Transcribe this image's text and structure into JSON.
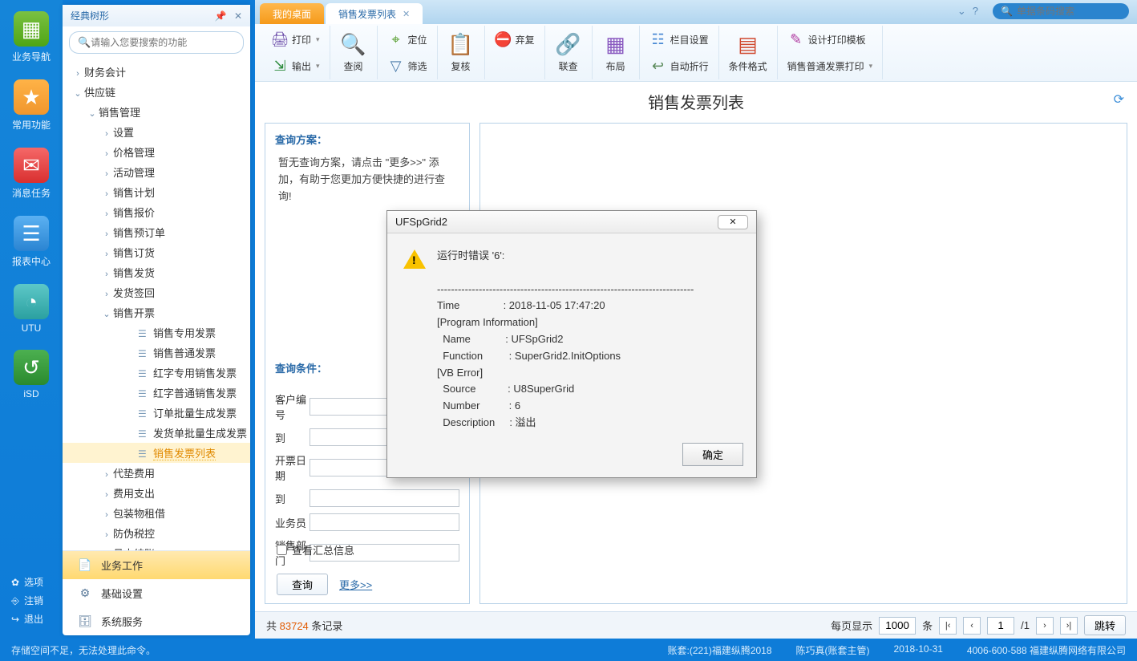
{
  "tree_panel_title": "经典树形",
  "tree_search_placeholder": "请输入您要搜索的功能",
  "rail": [
    {
      "label": "业务导航",
      "cls": "ri-green",
      "glyph": "▦"
    },
    {
      "label": "常用功能",
      "cls": "ri-orange",
      "glyph": "★"
    },
    {
      "label": "消息任务",
      "cls": "ri-red",
      "glyph": "✉"
    },
    {
      "label": "报表中心",
      "cls": "ri-blue",
      "glyph": "☰"
    },
    {
      "label": "UTU",
      "cls": "ri-teal",
      "glyph": "◔"
    },
    {
      "label": "iSD",
      "cls": "ri-dgreen",
      "glyph": "↺"
    }
  ],
  "rail_bottom": [
    {
      "ico": "✿",
      "label": "选项"
    },
    {
      "ico": "⎆",
      "label": "注销"
    },
    {
      "ico": "↪",
      "label": "退出"
    }
  ],
  "tree": [
    {
      "lvl": 0,
      "expand": "›",
      "label": "财务会计"
    },
    {
      "lvl": 0,
      "expand": "⌄",
      "label": "供应链"
    },
    {
      "lvl": 1,
      "expand": "⌄",
      "label": "销售管理"
    },
    {
      "lvl": 2,
      "expand": "›",
      "label": "设置"
    },
    {
      "lvl": 2,
      "expand": "›",
      "label": "价格管理"
    },
    {
      "lvl": 2,
      "expand": "›",
      "label": "活动管理"
    },
    {
      "lvl": 2,
      "expand": "›",
      "label": "销售计划"
    },
    {
      "lvl": 2,
      "expand": "›",
      "label": "销售报价"
    },
    {
      "lvl": 2,
      "expand": "›",
      "label": "销售预订单"
    },
    {
      "lvl": 2,
      "expand": "›",
      "label": "销售订货"
    },
    {
      "lvl": 2,
      "expand": "›",
      "label": "销售发货"
    },
    {
      "lvl": 2,
      "expand": "›",
      "label": "发货签回"
    },
    {
      "lvl": 2,
      "expand": "⌄",
      "label": "销售开票"
    },
    {
      "lvl": 3,
      "leaf": true,
      "label": "销售专用发票"
    },
    {
      "lvl": 3,
      "leaf": true,
      "label": "销售普通发票"
    },
    {
      "lvl": 3,
      "leaf": true,
      "label": "红字专用销售发票"
    },
    {
      "lvl": 3,
      "leaf": true,
      "label": "红字普通销售发票"
    },
    {
      "lvl": 3,
      "leaf": true,
      "label": "订单批量生成发票"
    },
    {
      "lvl": 3,
      "leaf": true,
      "label": "发货单批量生成发票"
    },
    {
      "lvl": 3,
      "leaf": true,
      "label": "销售发票列表",
      "active": true
    },
    {
      "lvl": 2,
      "expand": "›",
      "label": "代垫费用"
    },
    {
      "lvl": 2,
      "expand": "›",
      "label": "费用支出"
    },
    {
      "lvl": 2,
      "expand": "›",
      "label": "包装物租借"
    },
    {
      "lvl": 2,
      "expand": "›",
      "label": "防伪税控"
    },
    {
      "lvl": 2,
      "expand": "›",
      "label": "月末结账"
    }
  ],
  "tree_bottom": [
    {
      "ico": "📄",
      "label": "业务工作",
      "active": true
    },
    {
      "ico": "⚙",
      "label": "基础设置"
    },
    {
      "ico": "🗄",
      "label": "系统服务"
    }
  ],
  "tabs": [
    {
      "label": "我的桌面",
      "type": "home"
    },
    {
      "label": "销售发票列表",
      "type": "doc"
    }
  ],
  "topsearch_placeholder": "单据条码搜索",
  "ribbon": {
    "print": "打印",
    "export": "输出",
    "query": "查阅",
    "locate": "定位",
    "filter": "筛选",
    "review": "复核",
    "reject": "弃复",
    "link": "联查",
    "layout": "布局",
    "column": "栏目设置",
    "wrap": "自动折行",
    "cond": "条件格式",
    "tpl": "设计打印模板",
    "salesprint": "销售普通发票打印"
  },
  "page_title": "销售发票列表",
  "plan": {
    "head": "查询方案：",
    "text": "暂无查询方案，请点击 \"更多>>\" 添加，有助于您更加方便快捷的进行查询!"
  },
  "cond": {
    "head": "查询条件：",
    "labels": {
      "cust": "客户编号",
      "to": "到",
      "date": "开票日期",
      "to2": "到",
      "sales": "业务员",
      "dept": "销售部门"
    },
    "chk": "查看汇总信息",
    "query_btn": "查询",
    "more": "更多>>"
  },
  "footer": {
    "total_prefix": "共 ",
    "total": "83724",
    "total_suffix": " 条记录",
    "perpage_label": "每页显示",
    "perpage": "1000",
    "unit": "条",
    "page": "1",
    "pages": "1",
    "jump": "跳转"
  },
  "dialog": {
    "title": "UFSpGrid2",
    "line1": "运行时错误 '6':",
    "line2": "--------------------------------------------------------------------------",
    "body": "Time               : 2018-11-05 17:47:20\n[Program Information]\n  Name            : UFSpGrid2\n  Function         : SuperGrid2.InitOptions\n[VB Error]\n  Source           : U8SuperGrid\n  Number          : 6\n  Description     : 溢出",
    "ok": "确定"
  },
  "status": {
    "left": "存储空间不足，无法处理此命令。",
    "acct": "账套:(221)福建纵腾2018",
    "user": "陈巧真(账套主管)",
    "date": "2018-10-31",
    "tel": "4006-600-588 福建纵腾网络有限公司"
  }
}
